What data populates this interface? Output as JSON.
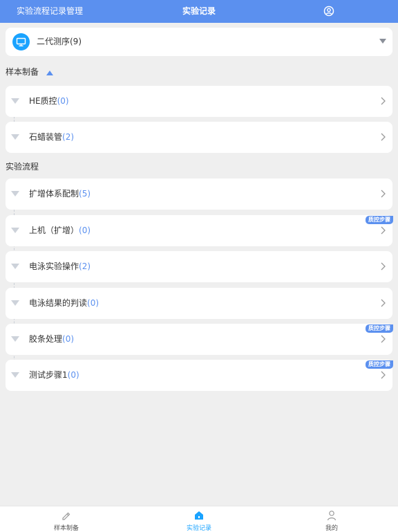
{
  "header": {
    "left_title": "实验流程记录管理",
    "center_title": "实验记录"
  },
  "selector": {
    "label": "二代测序(9)"
  },
  "sections": {
    "sample_prep": "样本制备",
    "experiment_flow": "实验流程"
  },
  "sample_steps": [
    {
      "name": "HE质控",
      "count": "(0)"
    },
    {
      "name": "石蜡装管",
      "count": "(2)"
    }
  ],
  "flow_steps": [
    {
      "name": "扩增体系配制",
      "count": "(5)"
    },
    {
      "name": "上机（扩增）",
      "count": "(0)",
      "badge": "质控步骤"
    },
    {
      "name": "电泳实验操作",
      "count": "(2)"
    },
    {
      "name": "电泳结果的判读",
      "count": "(0)"
    },
    {
      "name": "胶条处理",
      "count": "(0)",
      "badge": "质控步骤"
    },
    {
      "name": "测试步骤1",
      "count": "(0)",
      "badge": "质控步骤"
    }
  ],
  "bottom_nav": {
    "tabs": [
      {
        "label": "样本制备",
        "icon": "edit-icon"
      },
      {
        "label": "实验记录",
        "icon": "home-icon",
        "active": true
      },
      {
        "label": "我的",
        "icon": "user-icon"
      }
    ]
  },
  "colors": {
    "accent": "#5b90ef",
    "active_tab": "#1aa3ff",
    "background": "#efefef"
  }
}
